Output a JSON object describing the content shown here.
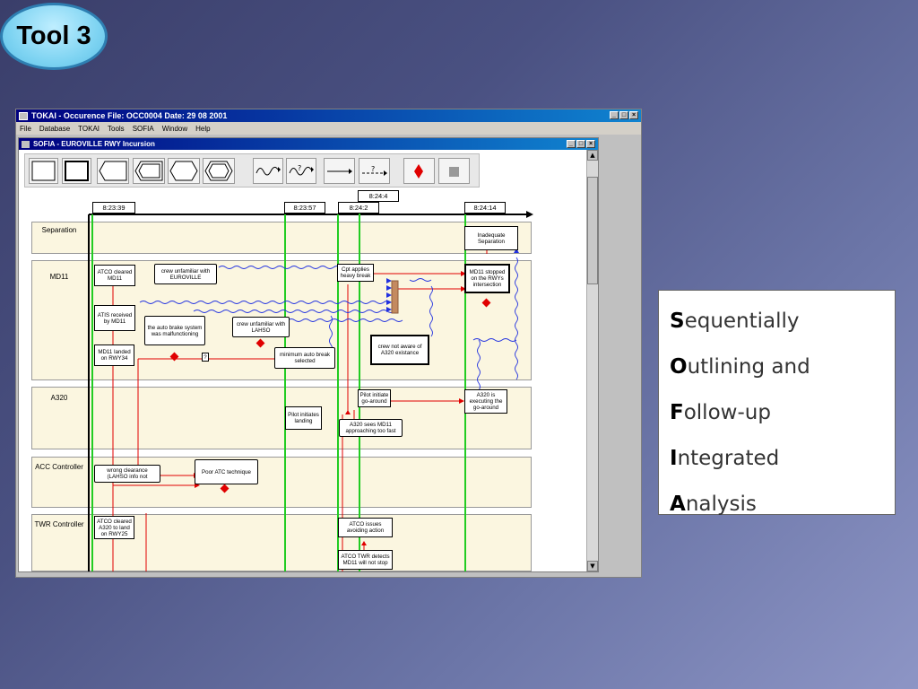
{
  "slide": {
    "badge": "Tool 3",
    "acronym": [
      {
        "first": "S",
        "rest": "equentially"
      },
      {
        "first": "O",
        "rest": "utlining and"
      },
      {
        "first": "F",
        "rest": "ollow-up"
      },
      {
        "first": "I",
        "rest": "ntegrated"
      },
      {
        "first": "A",
        "rest": "nalysis"
      }
    ]
  },
  "app": {
    "title": "TOKAI - Occurence File: OCC0004 Date: 29 08 2001",
    "menu": [
      "File",
      "Database",
      "TOKAI",
      "Tools",
      "SOFIA",
      "Window",
      "Help"
    ],
    "window_controls": [
      "_",
      "□",
      "×"
    ]
  },
  "inner": {
    "title": "SOFIA - EUROVILLE RWY Incursion",
    "tools": [
      "rect",
      "rect-bold",
      "hex-arrow-left",
      "hex-arrow-left-2",
      "hex",
      "hex-2",
      "wave-arrow",
      "wave-question-arrow",
      "arrow",
      "question-arrow",
      "red-diamond",
      "gray-square"
    ]
  },
  "timeline": {
    "times": [
      "8:23:39",
      "8:23:57",
      "8:24:4",
      "8:24:2",
      "8:24:14"
    ],
    "lanes": [
      "Separation",
      "MD11",
      "A320",
      "ACC Controller",
      "TWR Controller"
    ],
    "events": {
      "inadequate_separation": "Inadequate Separation",
      "atco_cleared_md11": "ATCO cleared MD11",
      "crew_unfamiliar_euroville": "crew unfamiliar with EUROVILLE",
      "cpt_applies_brake": "Cpt applies heavy break",
      "md11_stopped": "MD11 stopped on the RWYs intersection",
      "atis_received": "ATIS received by MD11",
      "auto_brake": "the auto brake system was malfunctioning",
      "crew_unfamiliar_lahso": "crew unfamiliar with LAHSO",
      "md11_landed": "MD11 landed on RWY34",
      "question": "?",
      "min_auto_brake": "minimum auto break selected",
      "crew_not_aware": "crew not aware of A320 existance",
      "pilot_initiates_goaround": "Pilot initiate go-around",
      "a320_executing": "A320 is executing the go-around",
      "pilot_initiates_landing": "Pilot initiates landing",
      "a320_sees_md11": "A320 sees MD11 approaching too fast",
      "wrong_clearance": "wrong clearance (LAHSO info not",
      "poor_atc": "Poor ATC technique",
      "atco_cleared_a320": "ATCO cleared A320 to land on RWY25",
      "atco_issues": "ATCO issues avoiding action",
      "atco_twr_detects": "ATCO TWR detects MD11 will not stop"
    }
  }
}
